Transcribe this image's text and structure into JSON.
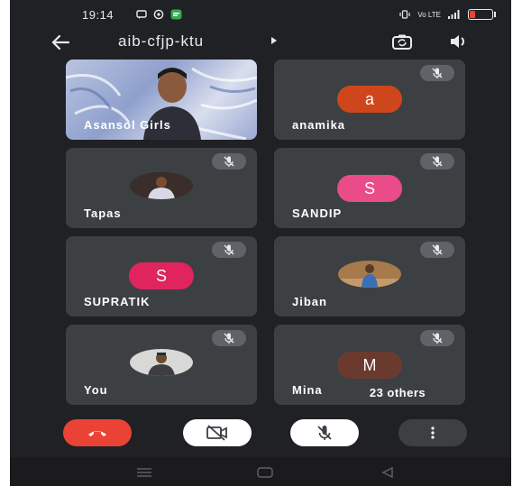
{
  "status_bar": {
    "time": "19:14",
    "signal_text": "Vo LTE"
  },
  "header": {
    "meeting_code": "aib-cfjp-ktu"
  },
  "participants": [
    {
      "name": "Asansol Girls",
      "avatar": "video-feed",
      "muted": false
    },
    {
      "name": "anamika",
      "avatar_letter": "a",
      "avatar_color": "#d0461c",
      "muted": true
    },
    {
      "name": "Tapas",
      "avatar": "photo",
      "muted": true
    },
    {
      "name": "SANDIP",
      "avatar_letter": "S",
      "avatar_color": "#ea4c89",
      "muted": true
    },
    {
      "name": "SUPRATIK",
      "avatar_letter": "S",
      "avatar_color": "#e0245e",
      "muted": true
    },
    {
      "name": "Jiban",
      "avatar": "photo",
      "muted": true
    },
    {
      "name": "You",
      "avatar": "photo",
      "muted": true
    },
    {
      "name": "Mina",
      "avatar_letter": "M",
      "avatar_color": "#6b3a2e",
      "muted": true
    }
  ],
  "others_label": "23 others",
  "controls": {
    "end_call_color": "#ea4335",
    "icons": [
      "phone-end-icon",
      "camera-off-icon",
      "mic-off-icon",
      "more-vert-icon"
    ]
  },
  "colors": {
    "background": "#202124",
    "tile": "#3c4043"
  }
}
